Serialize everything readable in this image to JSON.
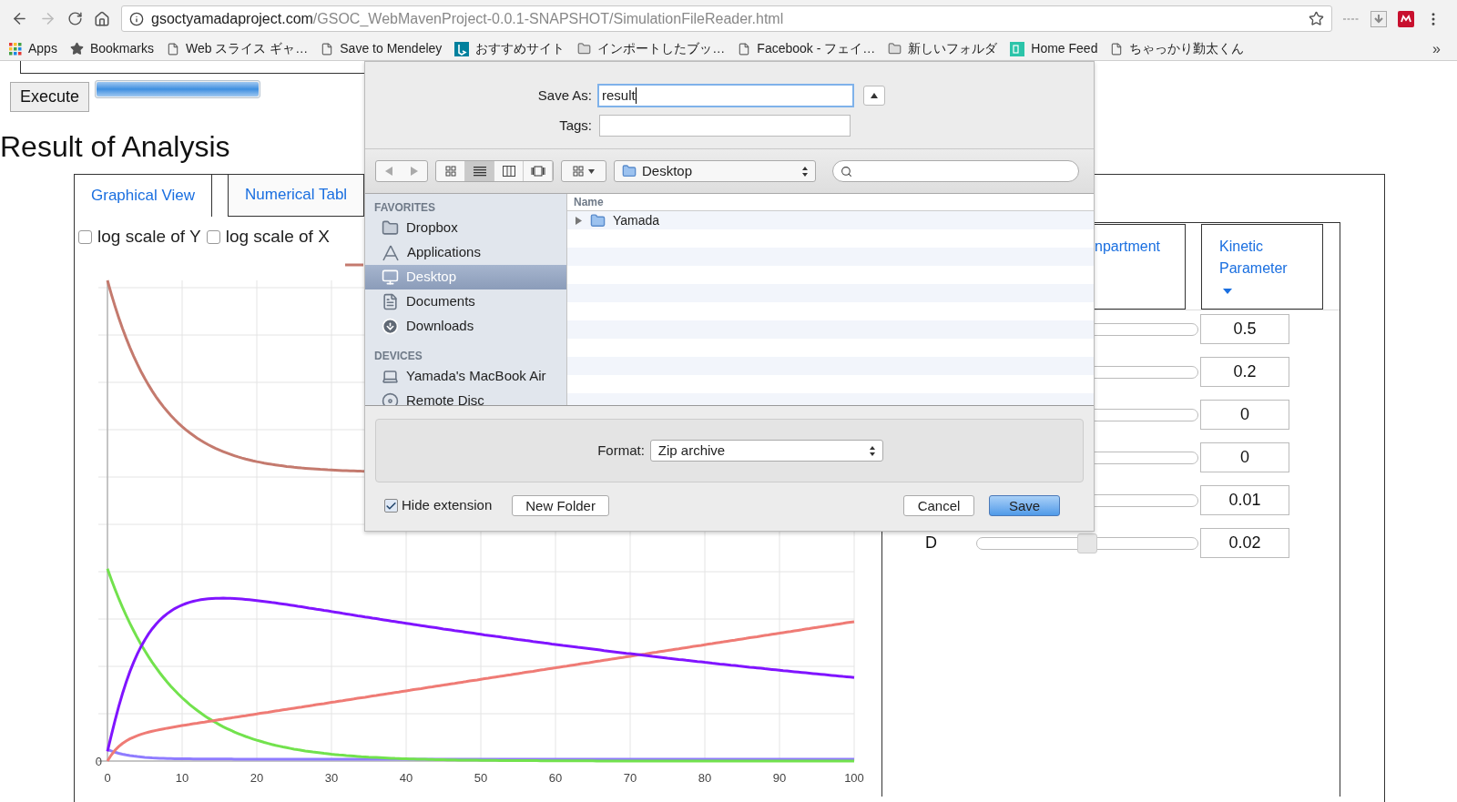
{
  "browser": {
    "url_host": "gsoctyamadaproject.com",
    "url_path": "/GSOC_WebMavenProject-0.0.1-SNAPSHOT/SimulationFileReader.html",
    "bookmarks": [
      {
        "label": "Apps",
        "kind": "apps"
      },
      {
        "label": "Bookmarks",
        "kind": "star"
      },
      {
        "label": "Web スライス ギャ…",
        "kind": "page"
      },
      {
        "label": "Save to Mendeley",
        "kind": "page"
      },
      {
        "label": "おすすめサイト",
        "kind": "bing"
      },
      {
        "label": "インポートしたブッ…",
        "kind": "folder"
      },
      {
        "label": "Facebook - フェイ…",
        "kind": "page"
      },
      {
        "label": "新しいフォルダ",
        "kind": "folder"
      },
      {
        "label": "Home Feed",
        "kind": "feed"
      },
      {
        "label": "ちゃっかり勤太くん",
        "kind": "page"
      }
    ],
    "more": "»"
  },
  "page": {
    "execute_button": "Execute",
    "progress": {
      "level": 1
    },
    "title": "Result of Analysis",
    "tabs": [
      {
        "label": "Graphical View",
        "selected": true
      },
      {
        "label": "Numerical Tabl",
        "selected": false
      }
    ],
    "options": [
      {
        "label": "log scale of Y",
        "checked": false
      },
      {
        "label": "log scale of X",
        "checked": false
      }
    ],
    "chart": {
      "y_tick": "0",
      "x_ticks": [
        "0",
        "10",
        "20",
        "30",
        "40",
        "50",
        "60",
        "70",
        "80",
        "90",
        "100"
      ]
    },
    "param_tabs": [
      {
        "label": "npartment",
        "selected": false
      },
      {
        "label": "Kinetic Parameter",
        "selected": true
      }
    ],
    "params": [
      {
        "value": "0.5"
      },
      {
        "value": "0.2"
      },
      {
        "value": "0"
      },
      {
        "value": "0"
      },
      {
        "value": "0.01"
      },
      {
        "label": "D",
        "value": "0.02",
        "level": 0.5
      }
    ]
  },
  "dialog": {
    "save_as_label": "Save As:",
    "save_as_value": "result",
    "tags_label": "Tags:",
    "views": [
      {
        "kind": "icon",
        "selected": false
      },
      {
        "kind": "list",
        "selected": true
      },
      {
        "kind": "columns",
        "selected": false
      },
      {
        "kind": "coverflow",
        "selected": false
      }
    ],
    "location": "Desktop",
    "sidebar": [
      {
        "heading": "FAVORITES",
        "items": [
          {
            "label": "Dropbox",
            "kind": "folder",
            "selected": false
          },
          {
            "label": "Applications",
            "kind": "apps",
            "selected": false
          },
          {
            "label": "Desktop",
            "kind": "desktop",
            "selected": true
          },
          {
            "label": "Documents",
            "kind": "documents",
            "selected": false
          },
          {
            "label": "Downloads",
            "kind": "downloads",
            "selected": false
          }
        ]
      },
      {
        "heading": "DEVICES",
        "items": [
          {
            "label": "Yamada's MacBook Air",
            "kind": "laptop",
            "selected": false
          },
          {
            "label": "Remote Disc",
            "kind": "disc",
            "selected": false
          }
        ]
      }
    ],
    "list_header": "Name",
    "files": [
      {
        "name": "Yamada",
        "expanded": false
      }
    ],
    "format_label": "Format:",
    "format_value": "Zip archive",
    "hide_extension": {
      "label": "Hide extension",
      "checked": true
    },
    "new_folder": "New Folder",
    "cancel": "Cancel",
    "save": "Save"
  }
}
